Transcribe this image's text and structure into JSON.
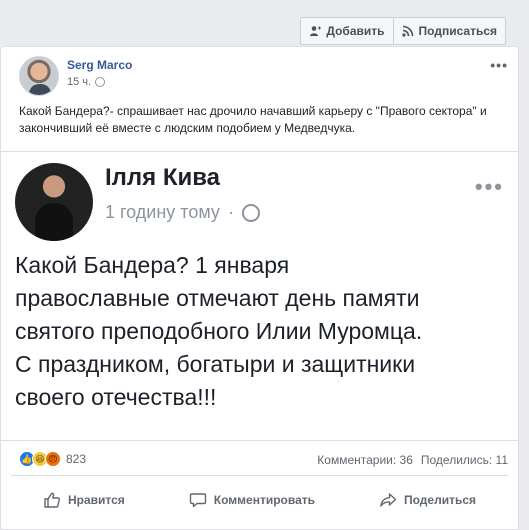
{
  "toolbar": {
    "add_label": "Добавить",
    "subscribe_label": "Подписаться"
  },
  "post": {
    "author": "Serg Marco",
    "time": "15 ч.",
    "text": "Какой Бандера?- спрашивает нас дрочило начавший карьеру с \"Правого сектора\" и закончивший её вместе с людским подобием у Медведчука."
  },
  "shared": {
    "author": "Ілля Кива",
    "time": "1 годину тому",
    "text_lines": [
      "Какой Бандера? 1 января",
      "православные  отмечают день памяти",
      "святого преподобного Илии Муромца.",
      "С праздником, богатыри и защитники",
      "своего отечества!!!"
    ]
  },
  "reactions": {
    "count": "823",
    "comments": "Комментарии: 36",
    "shares": "Поделились: 11"
  },
  "actions": {
    "like": "Нравится",
    "comment": "Комментировать",
    "share": "Поделиться"
  },
  "icons": {
    "add": "add-friend-icon",
    "subscribe": "rss-icon",
    "like": "thumbs-up-icon",
    "comment": "speech-bubble-icon",
    "share": "share-arrow-icon"
  }
}
